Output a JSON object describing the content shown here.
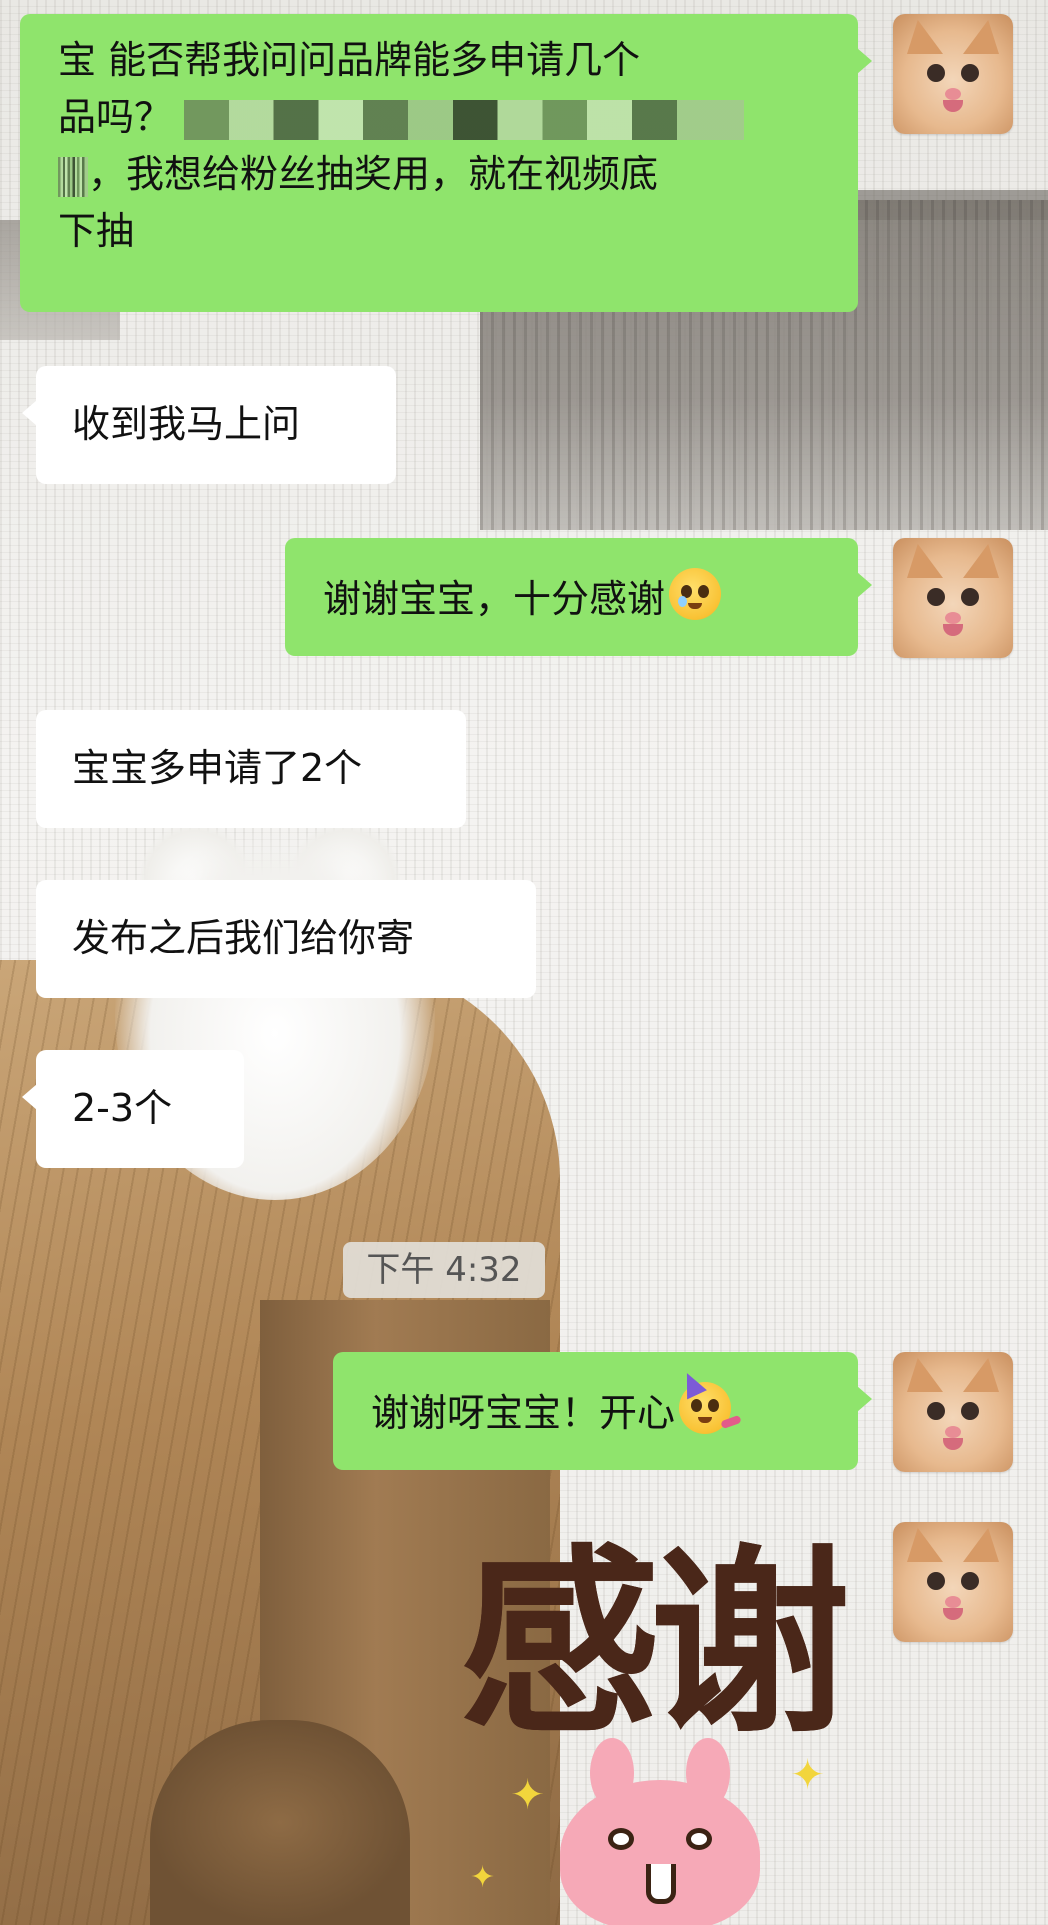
{
  "messages": [
    {
      "id": "m1",
      "sender": "me",
      "lines": [
        "宝 能否帮我问问品牌能多申请几个",
        "品吗？",
        "，我想给粉丝抽奖用，就在视频底",
        "下抽"
      ]
    },
    {
      "id": "m2",
      "sender": "them",
      "text": "收到我马上问"
    },
    {
      "id": "m3",
      "sender": "me",
      "text": "谢谢宝宝，十分感谢",
      "emoji": "pleading-face"
    },
    {
      "id": "m4",
      "sender": "them",
      "text": "宝宝多申请了2个"
    },
    {
      "id": "m5",
      "sender": "them",
      "text": "发布之后我们给你寄"
    },
    {
      "id": "m6",
      "sender": "them",
      "text": "2-3个"
    },
    {
      "id": "m7",
      "sender": "me",
      "text": "谢谢呀宝宝！开心",
      "emoji": "partying-face"
    },
    {
      "id": "m8",
      "sender": "me",
      "sticker_text": "感谢",
      "sticker_icon": "pink-bunny-sticker"
    }
  ],
  "timestamp": "下午 4:32",
  "colors": {
    "my_bubble": "#8fe46c",
    "their_bubble": "#ffffff",
    "timestamp_chip": "#e2ded8",
    "sticker_text": "#4a2719"
  }
}
